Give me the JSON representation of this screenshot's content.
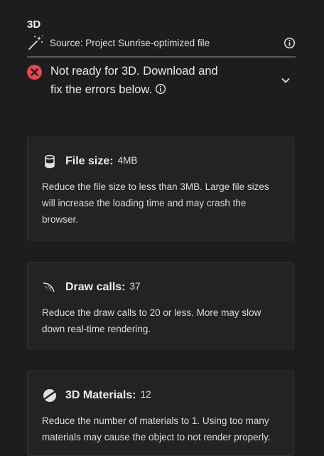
{
  "section": {
    "title": "3D"
  },
  "source": {
    "text": "Source: Project Sunrise-optimized file",
    "icon": "magic-wand-icon"
  },
  "status": {
    "line1": "Not ready for 3D. Download and",
    "line2": "fix the errors below.",
    "icon": "error-icon",
    "color": "#e34850"
  },
  "cards": [
    {
      "label": "File size:",
      "value": "4MB",
      "icon": "file-size-icon",
      "description": "Reduce the file size to less than 3MB. Large file sizes will increase the loading time and may crash the browser."
    },
    {
      "label": "Draw calls:",
      "value": "37",
      "icon": "draw-calls-icon",
      "description": "Reduce the draw calls to 20 or less. More may slow down real-time rendering."
    },
    {
      "label": "3D Materials:",
      "value": "12",
      "icon": "materials-icon",
      "description": "Reduce the number of materials to 1. Using too many materials may cause the object to not render properly."
    }
  ]
}
